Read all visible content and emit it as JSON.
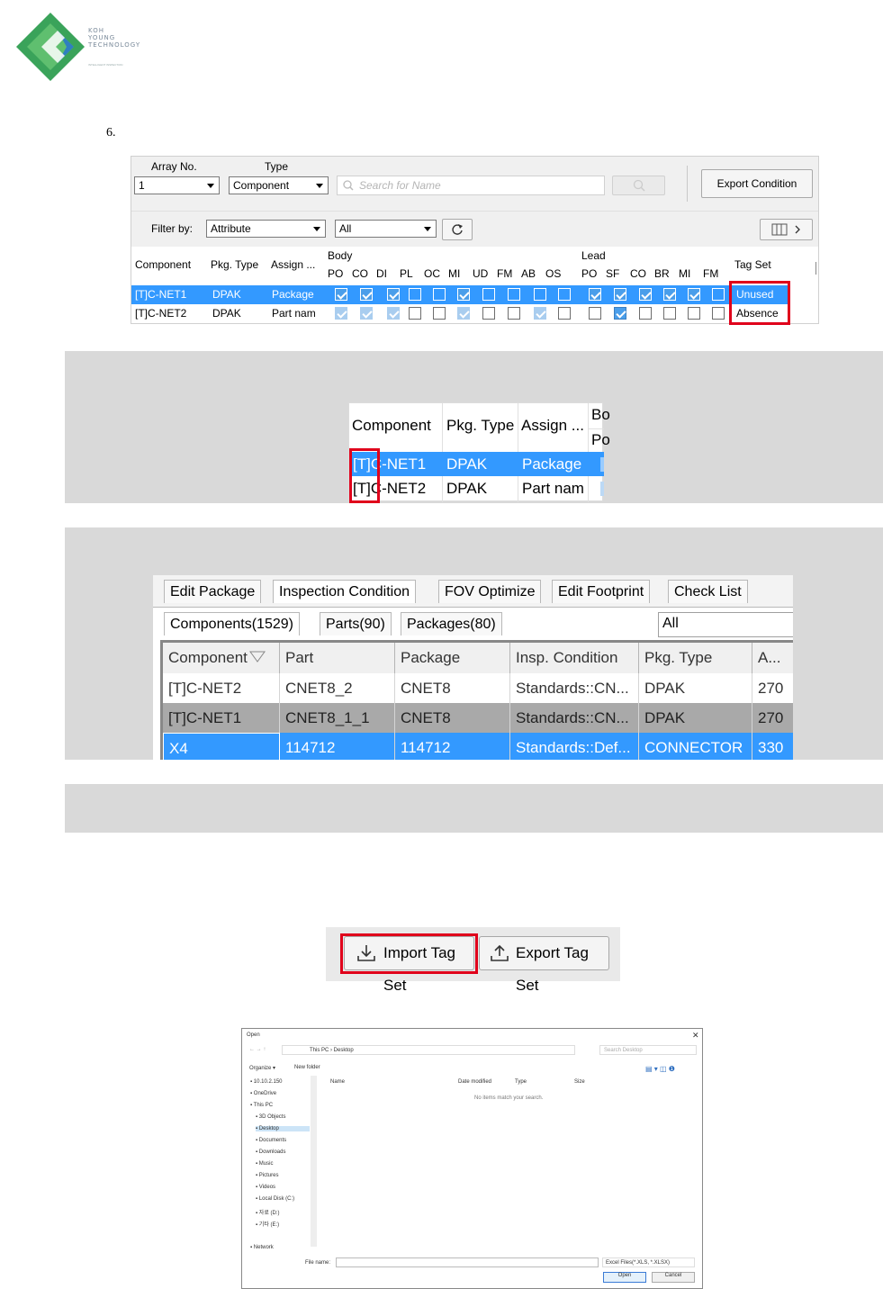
{
  "logo": {
    "lines": [
      "KOH",
      "YOUNG",
      "TECHNOLOGY"
    ],
    "tagline": "INTELLIGENT INSPECTION"
  },
  "step_number": "6.",
  "panel1": {
    "array_label": "Array No.",
    "array_value": "1",
    "type_label": "Type",
    "type_value": "Component",
    "search_placeholder": "Search for Name",
    "export_condition": "Export Condition",
    "filter_label": "Filter by:",
    "filter_value": "Attribute",
    "filter_all": "All",
    "columns": {
      "component": "Component",
      "pkg_type": "Pkg. Type",
      "assign": "Assign ...",
      "body": "Body",
      "lead": "Lead",
      "tag_set": "Tag Set",
      "body_cols": [
        "PO",
        "CO",
        "DI",
        "PL",
        "OC",
        "MI",
        "UD",
        "FM",
        "AB",
        "OS"
      ],
      "lead_cols": [
        "PO",
        "SF",
        "CO",
        "BR",
        "MI",
        "FM"
      ]
    },
    "rows": [
      {
        "component": "[T]C-NET1",
        "pkg_type": "DPAK",
        "assign": "Package",
        "body_checks": [
          true,
          true,
          true,
          false,
          false,
          true,
          false,
          false,
          false,
          false
        ],
        "lead_checks": [
          true,
          true,
          true,
          true,
          true,
          false
        ],
        "tag_set": "Unused"
      },
      {
        "component": "[T]C-NET2",
        "pkg_type": "DPAK",
        "assign": "Part nam",
        "body_checks": [
          true,
          true,
          true,
          false,
          false,
          true,
          false,
          false,
          true,
          false
        ],
        "lead_checks": [
          false,
          true,
          false,
          false,
          false,
          false
        ],
        "tag_set": "Absence"
      }
    ]
  },
  "zoom1": {
    "col_component": "Component",
    "col_pkg": "Pkg. Type",
    "col_assign": "Assign ...",
    "col_body_partial": "Bo",
    "col_po_partial": "Po",
    "rows": [
      {
        "component": "[T]C-NET1",
        "pkg": "DPAK",
        "assign": "Package"
      },
      {
        "component": "[T]C-NET2",
        "pkg": "DPAK",
        "assign": "Part nam"
      }
    ]
  },
  "tabs_panel": {
    "main_tabs": [
      "Edit Package",
      "Inspection Condition",
      "FOV Optimize",
      "Edit Footprint",
      "Check List"
    ],
    "sub_tabs": [
      "Components(1529)",
      "Parts(90)",
      "Packages(80)"
    ],
    "filter_value": "All",
    "columns": [
      "Component",
      "Part",
      "Package",
      "Insp. Condition",
      "Pkg. Type",
      "A..."
    ],
    "rows": [
      [
        "[T]C-NET2",
        "CNET8_2",
        "CNET8",
        "Standards::CN...",
        "DPAK",
        "270"
      ],
      [
        "[T]C-NET1",
        "CNET8_1_1",
        "CNET8",
        "Standards::CN...",
        "DPAK",
        "270"
      ],
      [
        "X4",
        "114712",
        "114712",
        "Standards::Def...",
        "CONNECTOR",
        "330"
      ]
    ]
  },
  "import_export": {
    "import_label": "Import Tag Set",
    "export_label": "Export Tag Set"
  },
  "dialog": {
    "title": "Open",
    "breadcrumb": "This PC › Desktop",
    "search_placeholder": "Search Desktop",
    "organize": "Organize ▾",
    "new_folder": "New folder",
    "col_name": "Name",
    "col_date": "Date modified",
    "col_type": "Type",
    "col_size": "Size",
    "empty_message": "No items match your search.",
    "nav_items": [
      "10.10.2.150",
      "OneDrive",
      "This PC",
      "3D Objects",
      "Desktop",
      "Documents",
      "Downloads",
      "Music",
      "Pictures",
      "Videos",
      "Local Disk (C:)",
      "자료 (D:)",
      "기타 (E:)",
      "Network"
    ],
    "file_name_label": "File name:",
    "file_type": "Excel Files(*.XLS, *.XLSX)",
    "open_button": "Open",
    "cancel_button": "Cancel"
  }
}
